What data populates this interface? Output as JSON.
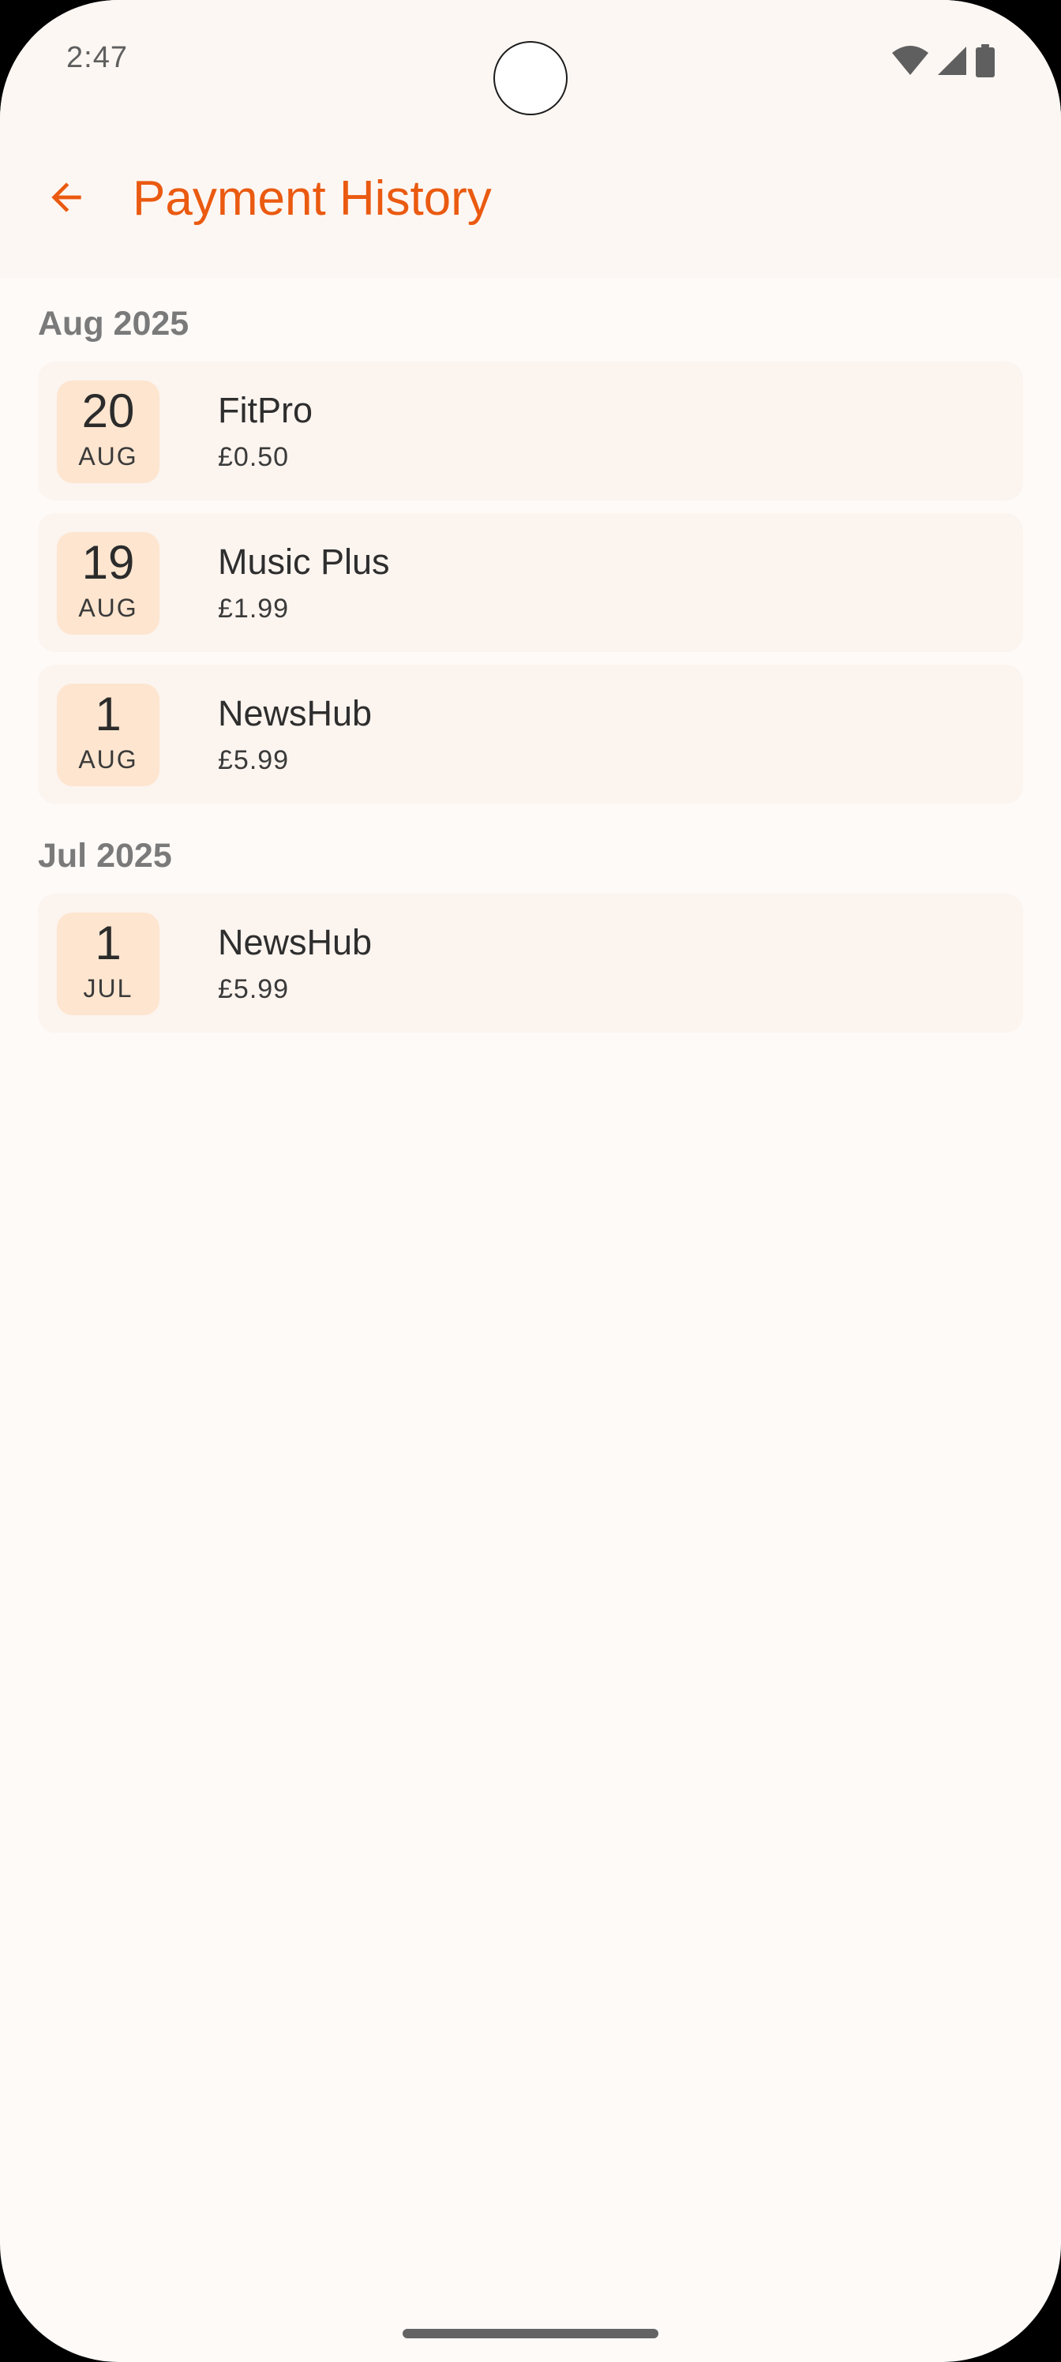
{
  "status_bar": {
    "time": "2:47",
    "icons": [
      "wifi-icon",
      "signal-icon",
      "battery-icon"
    ]
  },
  "app_bar": {
    "back_icon": "arrow-back-icon",
    "title": "Payment History"
  },
  "colors": {
    "accent": "#EA5A10",
    "background": "#FDFAF8",
    "card": "#FCF4EF",
    "date_badge": "#FDE5CF"
  },
  "sections": [
    {
      "header": "Aug 2025",
      "payments": [
        {
          "day": "20",
          "month": "AUG",
          "name": "FitPro",
          "amount": "£0.50"
        },
        {
          "day": "19",
          "month": "AUG",
          "name": "Music Plus",
          "amount": "£1.99"
        },
        {
          "day": "1",
          "month": "AUG",
          "name": "NewsHub",
          "amount": "£5.99"
        }
      ]
    },
    {
      "header": "Jul 2025",
      "payments": [
        {
          "day": "1",
          "month": "JUL",
          "name": "NewsHub",
          "amount": "£5.99"
        }
      ]
    }
  ]
}
